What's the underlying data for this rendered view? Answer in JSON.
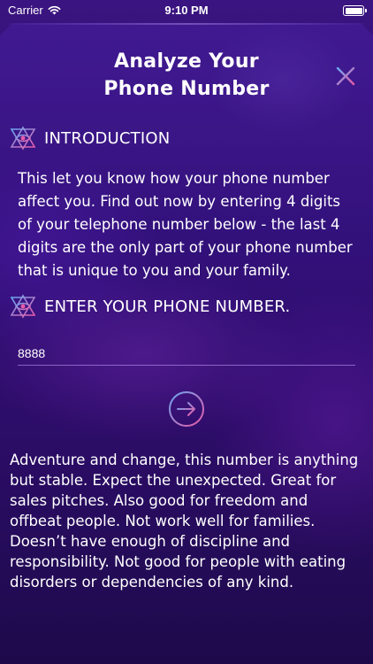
{
  "status_bar": {
    "carrier": "Carrier",
    "time": "9:10 PM"
  },
  "header": {
    "title_line1": "Analyze Your",
    "title_line2": "Phone Number",
    "close_icon": "close-x-icon"
  },
  "introduction": {
    "heading": "INTRODUCTION",
    "icon": "star-eye-icon",
    "text": "This let you know how your phone number affect you. Find out now by entering 4 digits of your telephone number below - the last 4 digits are the only part of your phone number that is unique to you and your family."
  },
  "enter_number": {
    "heading": "ENTER YOUR PHONE NUMBER.",
    "icon": "star-eye-icon",
    "input_value": "8888",
    "submit_icon": "arrow-right-circle-icon"
  },
  "result": {
    "text": "Adventure and change, this number is anything but stable. Expect the unexpected. Great for sales pitches. Also good for freedom and offbeat people. Not work well for families. Doesn’t have enough of discipline and responsibility. Not good for people with eating disorders or dependencies of any kind."
  },
  "colors": {
    "accent_pink": "#e85aa8",
    "accent_blue": "#6aa8f0",
    "background": "#2c0e6e"
  }
}
